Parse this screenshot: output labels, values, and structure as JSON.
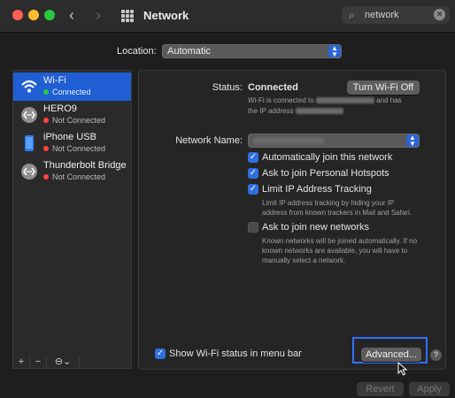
{
  "window": {
    "title": "Network",
    "search_value": "network",
    "traffic_light_colors": [
      "#ff5f57",
      "#febc2e",
      "#28c840"
    ]
  },
  "location": {
    "label": "Location:",
    "value": "Automatic"
  },
  "sidebar": {
    "items": [
      {
        "name": "Wi-Fi",
        "status": "Connected",
        "status_color": "#28c840",
        "icon": "wifi-icon"
      },
      {
        "name": "HERO9",
        "status": "Not Connected",
        "status_color": "#ff453a",
        "icon": "ethernet-icon"
      },
      {
        "name": "iPhone USB",
        "status": "Not Connected",
        "status_color": "#ff453a",
        "icon": "iphone-icon"
      },
      {
        "name": "Thunderbolt Bridge",
        "status": "Not Connected",
        "status_color": "#ff453a",
        "icon": "ethernet-icon"
      }
    ],
    "tools": {
      "add": "+",
      "remove": "−",
      "action": "⊖"
    }
  },
  "main": {
    "status_label": "Status:",
    "status_value": "Connected",
    "turn_off_button": "Turn Wi-Fi Off",
    "status_desc_line1a": "Wi-Fi is connected to",
    "status_desc_line1b": "and has",
    "status_desc_line2a": "the IP address",
    "network_name_label": "Network Name:",
    "checkboxes": {
      "auto_join": "Automatically join this network",
      "hotspots": "Ask to join Personal Hotspots",
      "limit_ip": "Limit IP Address Tracking",
      "ask_new": "Ask to join new networks"
    },
    "limit_ip_desc_1": "Limit IP address tracking by hiding your IP",
    "limit_ip_desc_2": "address from known trackers in Mail and Safari.",
    "ask_new_desc_1": "Known networks will be joined automatically. If no",
    "ask_new_desc_2": "known networks are available, you will have to",
    "ask_new_desc_3": "manually select a network.",
    "show_status": "Show Wi-Fi status in menu bar",
    "advanced_button": "Advanced...",
    "help": "?"
  },
  "footer": {
    "revert": "Revert",
    "apply": "Apply"
  }
}
